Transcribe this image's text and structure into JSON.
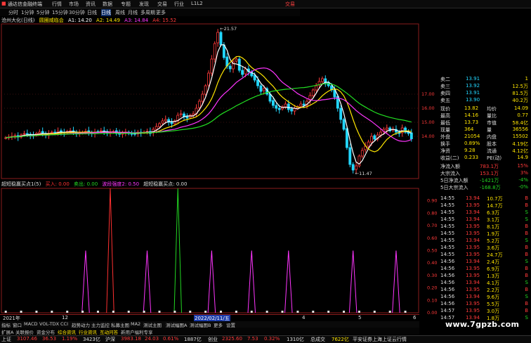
{
  "titlebar": {
    "app_name": "通达信金融终端",
    "menus": [
      "行情",
      "市场",
      "资讯",
      "数据",
      "专题",
      "发现",
      "交易",
      "行业",
      "L1L2"
    ],
    "right_label": "交易"
  },
  "periodbar": {
    "periods": [
      "分时",
      "1分钟",
      "5分钟",
      "15分钟",
      "30分钟",
      "日线",
      "周线",
      "月线",
      "多周期",
      "更多"
    ]
  },
  "main_header": {
    "stock": "沧州大化(日线)",
    "indicator": "圆圈威临会",
    "a1": "A1: 14.20",
    "a2": "A2: 14.49",
    "a3": "A3: 14.84",
    "a4": "A4: 15.52"
  },
  "chart_data": [
    {
      "type": "candlestick",
      "title": "沧州大化(日线)",
      "ylim": [
        11.0,
        22.0
      ],
      "yticks": [
        14.0,
        15.0,
        16.0,
        17.0
      ],
      "annotations": [
        "21.57",
        "11.47"
      ],
      "series_ma": [
        "A1",
        "A2",
        "A3",
        "A4"
      ],
      "colors": {
        "up": "#ff3a3a",
        "down": "#22d7ff",
        "a1": "#ffffff",
        "a2": "#ffe600",
        "a3": "#ff35ff",
        "a4": "#22e022"
      },
      "closes": [
        13.9,
        13.95,
        14.0,
        14.05,
        13.95,
        14.1,
        14.2,
        14.15,
        14.05,
        14.1,
        14.2,
        14.3,
        14.2,
        14.1,
        14.2,
        14.3,
        14.25,
        14.35,
        14.3,
        14.25,
        14.35,
        14.4,
        14.3,
        14.2,
        14.25,
        14.3,
        14.35,
        14.25,
        14.2,
        14.3,
        14.35,
        14.4,
        14.3,
        14.25,
        14.3,
        14.35,
        14.2,
        14.15,
        14.25,
        14.3,
        14.2,
        14.15,
        14.2,
        14.3,
        14.25,
        14.3,
        14.35,
        14.2,
        14.5,
        14.7,
        14.9,
        15.1,
        15.2,
        15.0,
        14.9,
        15.1,
        15.5,
        15.6,
        15.4,
        15.3,
        15.5,
        15.6,
        16.0,
        16.5,
        17.0,
        17.6,
        18.5,
        19.5,
        20.6,
        21.4,
        20.5,
        19.6,
        19.0,
        18.8,
        19.3,
        19.5,
        18.7,
        18.4,
        18.8,
        18.6,
        18.3,
        18.0,
        17.6,
        17.2,
        17.4,
        17.0,
        16.5,
        16.2,
        16.0,
        15.9,
        16.1,
        16.3,
        15.9,
        15.8,
        16.0,
        16.1,
        16.3,
        16.2,
        16.5,
        16.9,
        17.3,
        17.6,
        17.9,
        18.1,
        17.8,
        17.6,
        17.3,
        16.8,
        16.0,
        15.2,
        14.5,
        13.2,
        12.0,
        11.6,
        11.9,
        12.6,
        13.0,
        13.3,
        13.6,
        14.0,
        13.8,
        14.1,
        14.3,
        14.5,
        14.6,
        14.4,
        14.5,
        14.3,
        14.2,
        14.6,
        14.3,
        14.2,
        13.82
      ]
    },
    {
      "type": "bar",
      "title": "超短稳赢买点1(5)",
      "series": [
        {
          "name": "买入",
          "color": "#ff3030",
          "value": "0.00"
        },
        {
          "name": "卖出",
          "color": "#22d722",
          "value": "0.00"
        },
        {
          "name": "波段强度",
          "color": "#ff35ff",
          "value": "0.50"
        }
      ],
      "yticks": [
        0.9,
        0.8,
        0.7,
        0.6,
        0.5,
        0.4,
        0.3,
        0.2,
        0.1,
        0.0
      ],
      "ylim": [
        0,
        1.0
      ],
      "buy_index": 34,
      "sell_index": 56,
      "wave_indices": [
        26,
        46,
        67,
        80,
        92,
        113,
        127
      ]
    }
  ],
  "ind_header": {
    "name": "超短稳赢买点1(5)",
    "buy": "买入: 0.00",
    "sell": "卖出: 0.00",
    "wave": "波段强度2: 0.50",
    "extra": "超短稳赢买点: 0.00"
  },
  "quote_panel": {
    "ask_rows": [
      {
        "label": "卖二",
        "price": "13.91",
        "vol": "1"
      },
      {
        "label": "卖三",
        "price": "13.92",
        "vol": "12.5万"
      },
      {
        "label": "卖四",
        "price": "13.91",
        "vol": "81.5万"
      },
      {
        "label": "卖五",
        "price": "13.90",
        "vol": "40.2万"
      }
    ],
    "stats": [
      {
        "l1": "现价",
        "v1": "13.82",
        "l2": "均价",
        "v2": "14.09"
      },
      {
        "l1": "最高",
        "v1": "14.16",
        "l2": "量比",
        "v2": "0.77"
      },
      {
        "l1": "最低",
        "v1": "13.73",
        "l2": "市值",
        "v2": "58.4亿"
      },
      {
        "l1": "现量",
        "v1": "364",
        "l2": "量",
        "v2": "36556"
      },
      {
        "l1": "外盘",
        "v1": "21054",
        "l2": "内盘",
        "v2": "15502"
      },
      {
        "l1": "换手",
        "v1": "0.89%",
        "l2": "股本",
        "v2": "4.19亿"
      },
      {
        "l1": "净资",
        "v1": "9.28",
        "l2": "流通",
        "v2": "4.12亿"
      },
      {
        "l1": "收益(二)",
        "v1": "0.233",
        "l2": "PE(动)",
        "v2": "14.9"
      }
    ],
    "flows": [
      {
        "label": "净流入额",
        "value": "783.1万",
        "pct": "15%"
      },
      {
        "label": "大宗流入",
        "value": "153.1万",
        "pct": "3%"
      },
      {
        "label": "5日净流入额",
        "value": "-1421万",
        "pct": "-4%"
      },
      {
        "label": "5日大宗流入",
        "value": "-168.8万",
        "pct": "-0%"
      }
    ],
    "ticks": [
      {
        "t": "14:55",
        "p": "13.94",
        "v": "10.7万",
        "d": "B"
      },
      {
        "t": "14:55",
        "p": "13.95",
        "v": "14.7万",
        "d": "B"
      },
      {
        "t": "14:55",
        "p": "13.94",
        "v": "6.3万",
        "d": "S"
      },
      {
        "t": "14:55",
        "p": "13.94",
        "v": "3.1万",
        "d": "S"
      },
      {
        "t": "14:55",
        "p": "13.95",
        "v": "8.1万",
        "d": "B"
      },
      {
        "t": "14:55",
        "p": "13.95",
        "v": "1.9万",
        "d": "B"
      },
      {
        "t": "14:55",
        "p": "13.94",
        "v": "5.2万",
        "d": "S"
      },
      {
        "t": "14:55",
        "p": "13.95",
        "v": "3.6万",
        "d": "B"
      },
      {
        "t": "14:55",
        "p": "13.95",
        "v": "24.7万",
        "d": "B"
      },
      {
        "t": "14:56",
        "p": "13.94",
        "v": "2.4万",
        "d": "S"
      },
      {
        "t": "14:56",
        "p": "13.95",
        "v": "6.9万",
        "d": "B"
      },
      {
        "t": "14:56",
        "p": "13.95",
        "v": "1.3万",
        "d": "B"
      },
      {
        "t": "14:56",
        "p": "13.94",
        "v": "4.1万",
        "d": "S"
      },
      {
        "t": "14:56",
        "p": "13.95",
        "v": "2.2万",
        "d": "B"
      },
      {
        "t": "14:56",
        "p": "13.94",
        "v": "9.6万",
        "d": "S"
      },
      {
        "t": "14:56",
        "p": "13.95",
        "v": "5.5万",
        "d": "B"
      },
      {
        "t": "14:57",
        "p": "13.95",
        "v": "3.0万",
        "d": "B"
      },
      {
        "t": "14:57",
        "p": "13.94",
        "v": "1.8万",
        "d": "S"
      }
    ]
  },
  "xaxis": {
    "labels": [
      "2021年",
      "12",
      "2022/02/11/五",
      "4",
      "5",
      "6"
    ]
  },
  "tabs": [
    "指标",
    "窗口",
    "MACD",
    "VOL-TDX",
    "CCI",
    "趋势动力",
    "主力监控",
    "私募主图",
    "MA2",
    "测试主图",
    "测试幅图A",
    "测试幅图B",
    "更多",
    "设置"
  ],
  "tabs2": [
    "扩展A",
    "关联报价",
    "资金分布",
    "综合资讯",
    "行业资讯",
    "互动问答",
    "新用户福利专享"
  ],
  "status": {
    "sh_label": "上证",
    "sh_val": "3107.46",
    "sh_chg": "36.53",
    "sh_pct": "1.19%",
    "sh_amt": "3423亿",
    "hs_label": "沪深",
    "hs_val": "3983.18",
    "hs_chg": "24.03",
    "hs_pct": "0.61%",
    "hs_amt": "1887亿",
    "cy_label": "创业",
    "cy_val": "2325.60",
    "cy_chg": "7.53",
    "cy_pct": "0.32%",
    "cy_amt": "1310亿",
    "total_label": "总成交",
    "total_val": "7622亿",
    "ticker": "平安证券上海上证云行情"
  },
  "watermark": "www.7gpzb.com"
}
